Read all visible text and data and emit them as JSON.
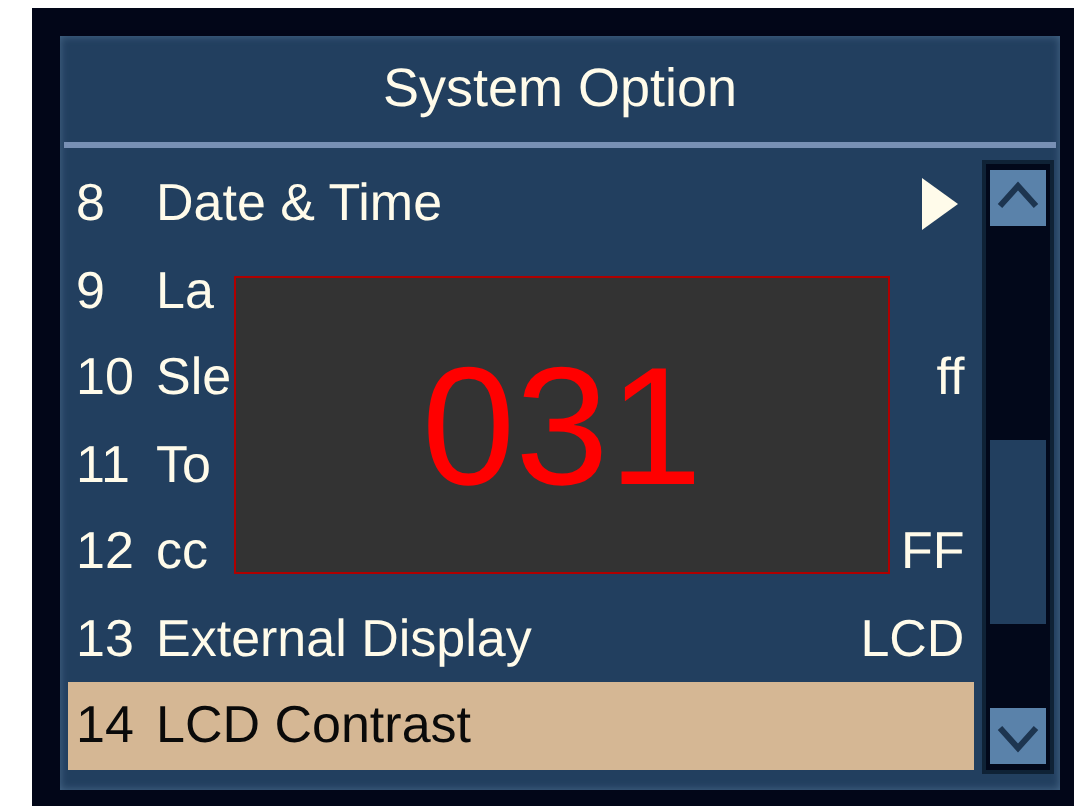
{
  "menu": {
    "title": "System Option",
    "rows": [
      {
        "number": "8",
        "label": "Date & Time",
        "kind": "arrow",
        "selected": false
      },
      {
        "number": "9",
        "label": "La",
        "kind": "plain",
        "selected": false
      },
      {
        "number": "10",
        "label": "Sle",
        "kind": "value",
        "value": "ff",
        "selected": false
      },
      {
        "number": "11",
        "label": "To",
        "kind": "plain",
        "selected": false
      },
      {
        "number": "12",
        "label": "cc",
        "kind": "value",
        "value": "FF",
        "selected": false
      },
      {
        "number": "13",
        "label": "External Display",
        "kind": "value",
        "value": "LCD",
        "selected": false
      },
      {
        "number": "14",
        "label": "LCD Contrast",
        "kind": "plain",
        "selected": true
      }
    ]
  },
  "popup": {
    "value": "031"
  }
}
